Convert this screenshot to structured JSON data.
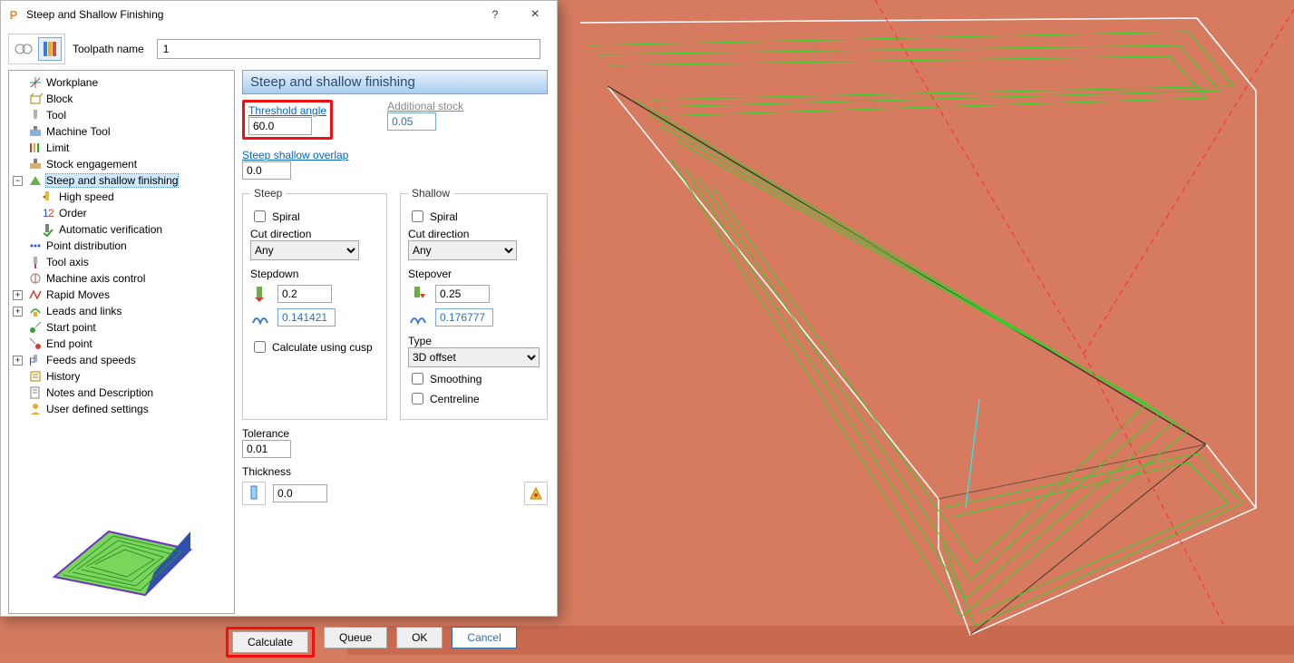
{
  "titlebar": {
    "title": "Steep and Shallow Finishing",
    "help": "?",
    "close": "×"
  },
  "toolpath": {
    "label": "Toolpath name",
    "value": "1"
  },
  "tree": {
    "items": [
      {
        "label": "Workplane",
        "icon": "workplane"
      },
      {
        "label": "Block",
        "icon": "block"
      },
      {
        "label": "Tool",
        "icon": "tool"
      },
      {
        "label": "Machine Tool",
        "icon": "machinetool"
      },
      {
        "label": "Limit",
        "icon": "limit"
      },
      {
        "label": "Stock engagement",
        "icon": "stockeng"
      },
      {
        "label": "Steep and shallow finishing",
        "icon": "steepshallow",
        "expanded": true,
        "selected": true,
        "children": [
          {
            "label": "High speed",
            "icon": "highspeed"
          },
          {
            "label": "Order",
            "icon": "order"
          },
          {
            "label": "Automatic verification",
            "icon": "autoverify"
          }
        ]
      },
      {
        "label": "Point distribution",
        "icon": "pointdist"
      },
      {
        "label": "Tool axis",
        "icon": "toolaxis"
      },
      {
        "label": "Machine axis control",
        "icon": "machineaxis"
      },
      {
        "label": "Rapid Moves",
        "icon": "rapid",
        "expandable": true
      },
      {
        "label": "Leads and links",
        "icon": "leads",
        "expandable": true
      },
      {
        "label": "Start point",
        "icon": "startpt"
      },
      {
        "label": "End point",
        "icon": "endpt"
      },
      {
        "label": "Feeds and speeds",
        "icon": "feeds",
        "expandable": true
      },
      {
        "label": "History",
        "icon": "history"
      },
      {
        "label": "Notes and Description",
        "icon": "notes"
      },
      {
        "label": "User defined settings",
        "icon": "userdef"
      }
    ]
  },
  "panel": {
    "title": "Steep and shallow finishing",
    "threshold": {
      "label": "Threshold angle",
      "value": "60.0"
    },
    "addstock": {
      "label": "Additional stock",
      "value": "0.05"
    },
    "overlap": {
      "label": "Steep shallow overlap",
      "value": "0.0"
    },
    "steep": {
      "legend": "Steep",
      "spiral": "Spiral",
      "cutdir_label": "Cut direction",
      "cutdir": "Any",
      "stepdown_label": "Stepdown",
      "stepdown": "0.2",
      "cusp": "0.141421",
      "calc_cusp": "Calculate using cusp"
    },
    "shallow": {
      "legend": "Shallow",
      "spiral": "Spiral",
      "cutdir_label": "Cut direction",
      "cutdir": "Any",
      "stepover_label": "Stepover",
      "stepover": "0.25",
      "cusp": "0.176777",
      "type_label": "Type",
      "type": "3D offset",
      "smoothing": "Smoothing",
      "centreline": "Centreline"
    },
    "tolerance": {
      "label": "Tolerance",
      "value": "0.01"
    },
    "thickness": {
      "label": "Thickness",
      "value": "0.0"
    }
  },
  "buttons": {
    "calculate": "Calculate",
    "queue": "Queue",
    "ok": "OK",
    "cancel": "Cancel"
  }
}
